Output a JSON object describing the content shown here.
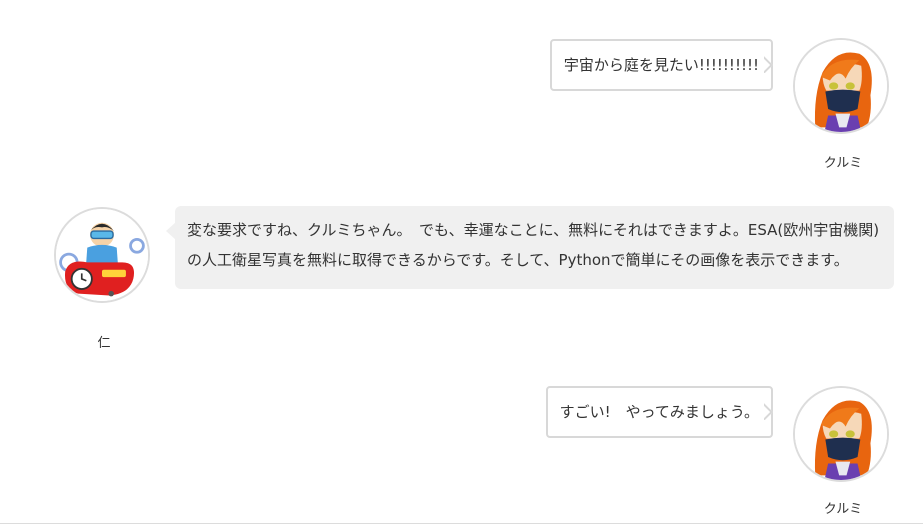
{
  "messages": [
    {
      "speaker": "クルミ",
      "side": "right",
      "text": "宇宙から庭を見たい!!!!!!!!!!"
    },
    {
      "speaker": "仁",
      "side": "left",
      "text": "変な要求ですね、クルミちゃん。　でも、幸運なことに、無料にそれはできますよ。ESA(欧州宇宙機関)の人工衛星写真を無料に取得できるからです。そして、Pythonで簡単にその画像を表示できます。"
    },
    {
      "speaker": "クルミ",
      "side": "right",
      "text": "すごい!　やってみましょう。"
    }
  ],
  "colors": {
    "bubble_border": "#d8d8d8",
    "bubble_fill": "#f0f0f0",
    "kurumi_hair": "#e8650f",
    "kurumi_mask": "#1f2f4f"
  }
}
